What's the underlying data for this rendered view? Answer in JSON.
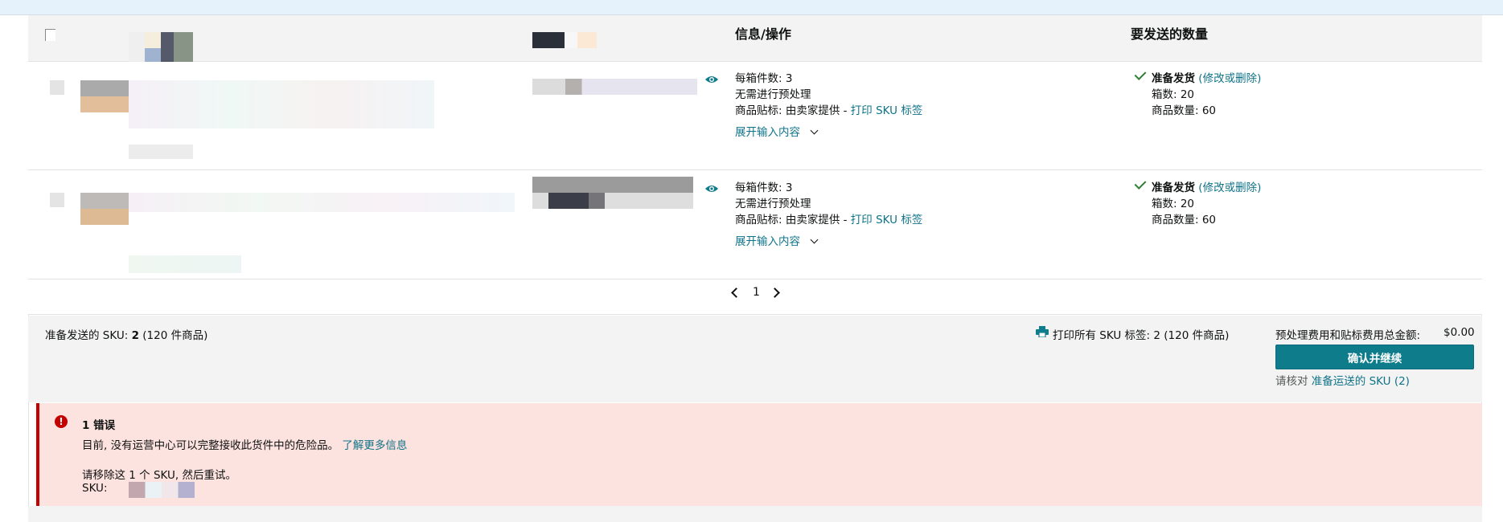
{
  "table": {
    "col_info": "信息/操作",
    "col_qty": "要发送的数量"
  },
  "rows": [
    {
      "units_per_box": "每箱件数: 3",
      "prep": "无需进行预处理",
      "label_prefix": "商品贴标:  由卖家提供 - ",
      "label_link": "打印 SKU 标签",
      "expand": "展开输入内容",
      "ready": "准备发货",
      "modify": "(修改或删除)",
      "boxes": "箱数:  20",
      "units": "商品数量:  60"
    },
    {
      "units_per_box": "每箱件数: 3",
      "prep": "无需进行预处理",
      "label_prefix": "商品贴标:  由卖家提供 - ",
      "label_link": "打印 SKU 标签",
      "expand": "展开输入内容",
      "ready": "准备发货",
      "modify": "(修改或删除)",
      "boxes": "箱数:  20",
      "units": "商品数量:  60"
    }
  ],
  "pager": {
    "page": "1"
  },
  "footer": {
    "sku_prefix": "准备发送的 SKU:",
    "sku_count": "2",
    "sku_suffix": "(120 件商品)",
    "print_all": "打印所有 SKU 标签:  2 (120 件商品)",
    "fee_label": "预处理费用和贴标费用总金额:",
    "fee_value": "$0.00",
    "confirm": "确认并继续",
    "review_prefix": "请核对",
    "review_link": "准备运送的 SKU (2)"
  },
  "error": {
    "title": "1 错误",
    "message": "目前, 没有运营中心可以完整接收此货件中的危险品。",
    "learn_more": "了解更多信息",
    "remove": "请移除这 1 个 SKU, 然后重试。",
    "sku_label": "SKU:"
  },
  "colors": {
    "accent": "#0f7c8c",
    "link": "#0f7388",
    "error": "#c40000",
    "error_bg": "#fde3df"
  }
}
